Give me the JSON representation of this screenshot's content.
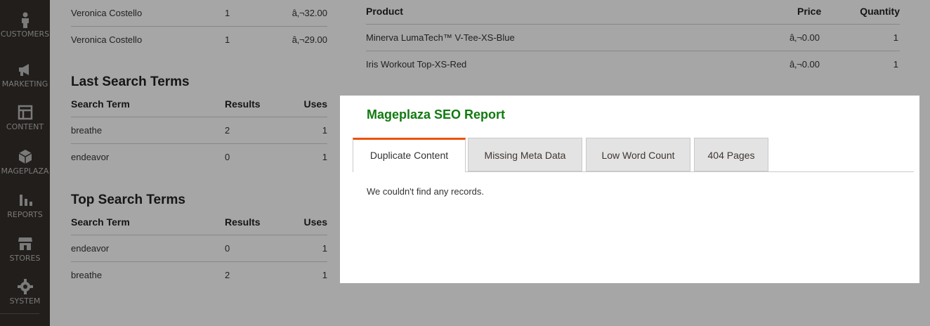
{
  "sidebar": {
    "items": [
      {
        "label": "CUSTOMERS",
        "icon": "person-icon"
      },
      {
        "label": "MARKETING",
        "icon": "megaphone-icon"
      },
      {
        "label": "CONTENT",
        "icon": "layout-icon"
      },
      {
        "label": "MAGEPLAZA",
        "icon": "box-icon"
      },
      {
        "label": "REPORTS",
        "icon": "bar-chart-icon"
      },
      {
        "label": "STORES",
        "icon": "storefront-icon"
      },
      {
        "label": "SYSTEM",
        "icon": "gear-icon"
      }
    ]
  },
  "customers_rows": [
    {
      "name": "Veronica Costello",
      "qty": "1",
      "total": "â‚¬32.00"
    },
    {
      "name": "Veronica Costello",
      "qty": "1",
      "total": "â‚¬29.00"
    }
  ],
  "products": {
    "headers": {
      "product": "Product",
      "price": "Price",
      "quantity": "Quantity"
    },
    "rows": [
      {
        "product": "Minerva LumaTech™ V-Tee-XS-Blue",
        "price": "â‚¬0.00",
        "quantity": "1"
      },
      {
        "product": "Iris Workout Top-XS-Red",
        "price": "â‚¬0.00",
        "quantity": "1"
      }
    ]
  },
  "last_search": {
    "title": "Last Search Terms",
    "headers": {
      "term": "Search Term",
      "results": "Results",
      "uses": "Uses"
    },
    "rows": [
      {
        "term": "breathe",
        "results": "2",
        "uses": "1"
      },
      {
        "term": "endeavor",
        "results": "0",
        "uses": "1"
      }
    ]
  },
  "top_search": {
    "title": "Top Search Terms",
    "headers": {
      "term": "Search Term",
      "results": "Results",
      "uses": "Uses"
    },
    "rows": [
      {
        "term": "endeavor",
        "results": "0",
        "uses": "1"
      },
      {
        "term": "breathe",
        "results": "2",
        "uses": "1"
      }
    ]
  },
  "modal": {
    "title": "Mageplaza SEO Report",
    "tabs": [
      {
        "label": "Duplicate Content",
        "active": true
      },
      {
        "label": "Missing Meta Data",
        "active": false
      },
      {
        "label": "Low Word Count",
        "active": false
      },
      {
        "label": "404 Pages",
        "active": false
      }
    ],
    "empty_message": "We couldn't find any records."
  },
  "colors": {
    "sidebar_bg": "#211e1b",
    "modal_title": "#117a0f",
    "active_tab_accent": "#eb5202"
  }
}
